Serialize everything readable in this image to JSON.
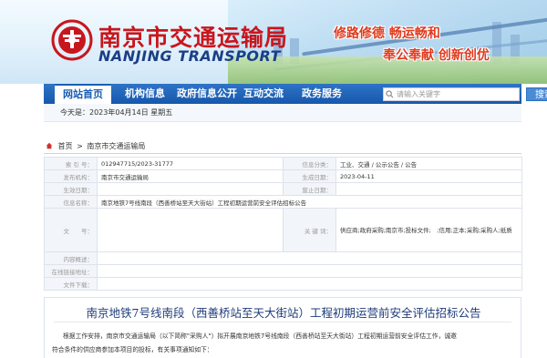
{
  "header": {
    "title_cn": "南京市交通运输局",
    "title_en": "NANJING TRANSPORT",
    "slogan_1": "修路修德  畅运畅和",
    "slogan_2": "奉公奉献  创新创优",
    "logo_icon": "transport-emblem-icon",
    "brand_color": "#c8161d"
  },
  "nav": {
    "items": [
      {
        "label": "网站首页",
        "active": true
      },
      {
        "label": "机构信息"
      },
      {
        "label": "政府信息公开"
      },
      {
        "label": "互动交流"
      },
      {
        "label": "政务服务"
      }
    ],
    "search_placeholder": "请输入关键字",
    "search_label": "搜索",
    "accent": "#1a5fb4"
  },
  "date_line": "今天是：2023年04月14日 星期五",
  "breadcrumb": {
    "home": "首页",
    "sep": ">",
    "current": "南京市交通运输局"
  },
  "info": {
    "index_label": "索 引 号：",
    "index_value": "012947715/2023-31777",
    "category_label": "信息分类：",
    "category_value": "工业、交通 / 公示公告 / 公告",
    "publisher_label": "发布机构：",
    "publisher_value": "南京市交通运输局",
    "date_label": "生成日期：",
    "date_value": "2023-04-11",
    "effective_label": "生效日期：",
    "effective_value": "",
    "expire_label": "废止日期：",
    "expire_value": "",
    "name_label": "信息名称：",
    "name_value": "南京地铁7号线南段（西善桥站至天大街站）工程初期运营前安全评估招标公告",
    "docno_label": "文　　号：",
    "docno_value": "",
    "keywords_label": "关 键 词：",
    "keywords_value": "供应商;政府采购;南京市;投标文件;　;信用;正本;采购;采购人;纸质",
    "overview_label": "内容概述：",
    "overview_value": "",
    "online_label": "在线链接地址：",
    "online_value": "",
    "download_label": "文件下载：",
    "download_value": ""
  },
  "article": {
    "title": "南京地铁7号线南段（西善桥站至天大街站）工程初期运营前安全评估招标公告",
    "para_1": "根据工作安排，南京市交通运输局（以下简称\"采购人\"）拟开展南京地铁7号线南段（西善桥站至天大街站）工程初期运营前安全评估工作，诚邀",
    "para_2": "符合条件的供应商参加本项目的投标，有关事项通知如下："
  }
}
